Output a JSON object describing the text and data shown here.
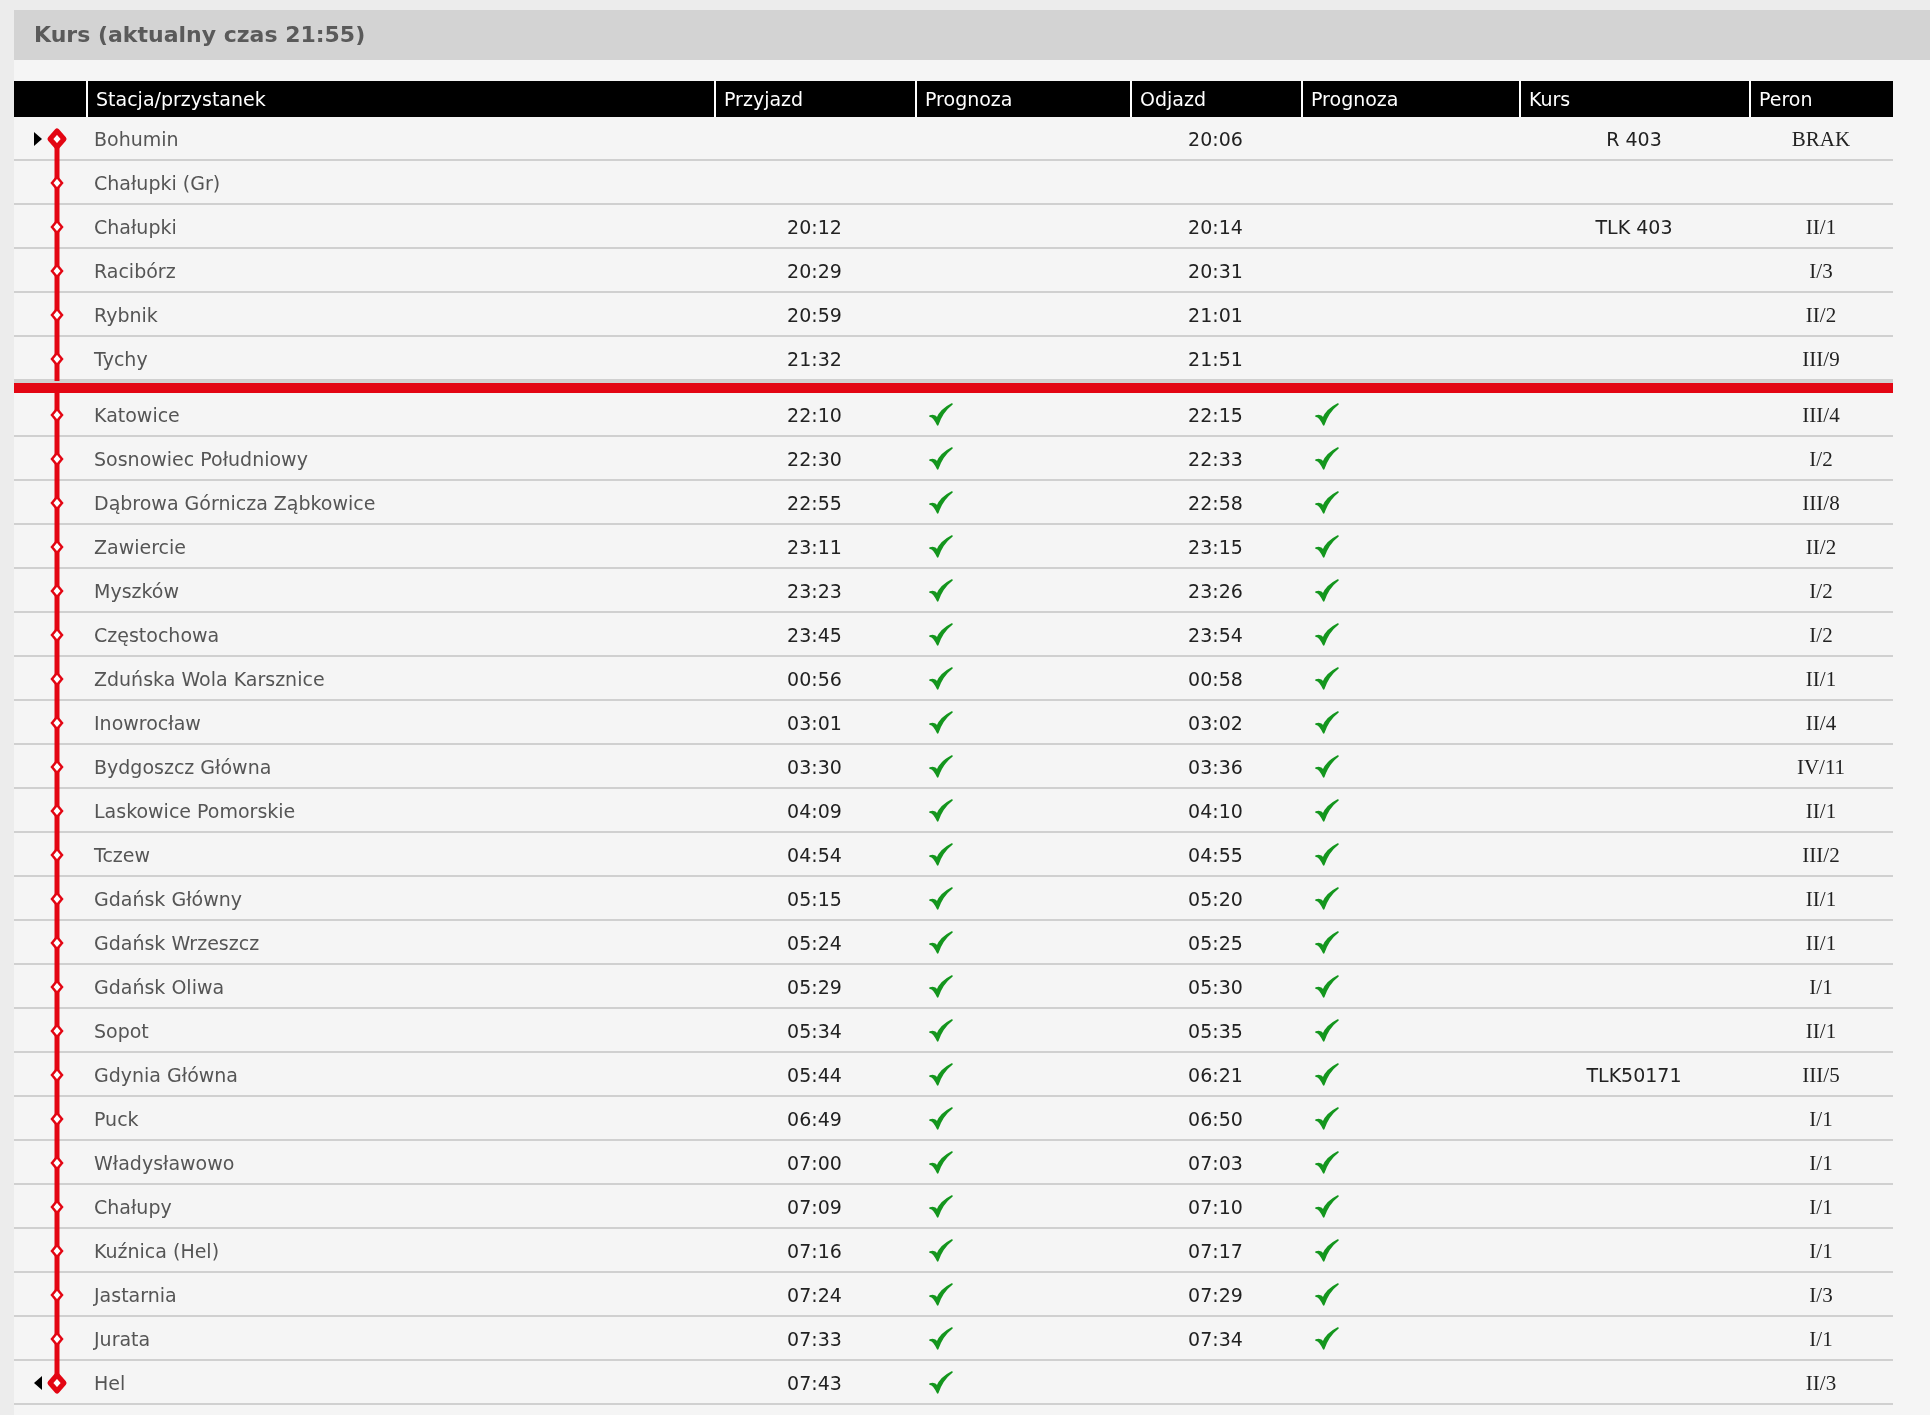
{
  "title": "Kurs (aktualny czas 21:55)",
  "columns": [
    "Stacja/przystanek",
    "Przyjazd",
    "Prognoza",
    "Odjazd",
    "Prognoza",
    "Kurs",
    "Peron"
  ],
  "rows": [
    {
      "kind": "start",
      "station": "Bohumin",
      "departure": "20:06",
      "train": "R 403",
      "platform": "BRAK",
      "arrival_forecast": false,
      "departure_forecast": false
    },
    {
      "kind": "stop",
      "station": "Chałupki (Gr)",
      "arrival_forecast": false,
      "departure_forecast": false
    },
    {
      "kind": "stop",
      "station": "Chałupki",
      "arrival": "20:12",
      "departure": "20:14",
      "train": "TLK 403",
      "platform": "II/1",
      "arrival_forecast": false,
      "departure_forecast": false
    },
    {
      "kind": "stop",
      "station": "Racibórz",
      "arrival": "20:29",
      "departure": "20:31",
      "platform": "I/3",
      "arrival_forecast": false,
      "departure_forecast": false
    },
    {
      "kind": "stop",
      "station": "Rybnik",
      "arrival": "20:59",
      "departure": "21:01",
      "platform": "II/2",
      "arrival_forecast": false,
      "departure_forecast": false
    },
    {
      "kind": "stop",
      "station": "Tychy",
      "arrival": "21:32",
      "departure": "21:51",
      "platform": "III/9",
      "arrival_forecast": false,
      "departure_forecast": false
    },
    {
      "kind": "now"
    },
    {
      "kind": "stop",
      "station": "Katowice",
      "arrival": "22:10",
      "departure": "22:15",
      "platform": "III/4",
      "arrival_forecast": true,
      "departure_forecast": true
    },
    {
      "kind": "stop",
      "station": "Sosnowiec Południowy",
      "arrival": "22:30",
      "departure": "22:33",
      "platform": "I/2",
      "arrival_forecast": true,
      "departure_forecast": true
    },
    {
      "kind": "stop",
      "station": "Dąbrowa Górnicza Ząbkowice",
      "arrival": "22:55",
      "departure": "22:58",
      "platform": "III/8",
      "arrival_forecast": true,
      "departure_forecast": true
    },
    {
      "kind": "stop",
      "station": "Zawiercie",
      "arrival": "23:11",
      "departure": "23:15",
      "platform": "II/2",
      "arrival_forecast": true,
      "departure_forecast": true
    },
    {
      "kind": "stop",
      "station": "Myszków",
      "arrival": "23:23",
      "departure": "23:26",
      "platform": "I/2",
      "arrival_forecast": true,
      "departure_forecast": true
    },
    {
      "kind": "stop",
      "station": "Częstochowa",
      "arrival": "23:45",
      "departure": "23:54",
      "platform": "I/2",
      "arrival_forecast": true,
      "departure_forecast": true
    },
    {
      "kind": "stop",
      "station": "Zduńska Wola Karsznice",
      "arrival": "00:56",
      "departure": "00:58",
      "platform": "II/1",
      "arrival_forecast": true,
      "departure_forecast": true
    },
    {
      "kind": "stop",
      "station": "Inowrocław",
      "arrival": "03:01",
      "departure": "03:02",
      "platform": "II/4",
      "arrival_forecast": true,
      "departure_forecast": true
    },
    {
      "kind": "stop",
      "station": "Bydgoszcz Główna",
      "arrival": "03:30",
      "departure": "03:36",
      "platform": "IV/11",
      "arrival_forecast": true,
      "departure_forecast": true
    },
    {
      "kind": "stop",
      "station": "Laskowice Pomorskie",
      "arrival": "04:09",
      "departure": "04:10",
      "platform": "II/1",
      "arrival_forecast": true,
      "departure_forecast": true
    },
    {
      "kind": "stop",
      "station": "Tczew",
      "arrival": "04:54",
      "departure": "04:55",
      "platform": "III/2",
      "arrival_forecast": true,
      "departure_forecast": true
    },
    {
      "kind": "stop",
      "station": "Gdańsk Główny",
      "arrival": "05:15",
      "departure": "05:20",
      "platform": "II/1",
      "arrival_forecast": true,
      "departure_forecast": true
    },
    {
      "kind": "stop",
      "station": "Gdańsk Wrzeszcz",
      "arrival": "05:24",
      "departure": "05:25",
      "platform": "II/1",
      "arrival_forecast": true,
      "departure_forecast": true
    },
    {
      "kind": "stop",
      "station": "Gdańsk Oliwa",
      "arrival": "05:29",
      "departure": "05:30",
      "platform": "I/1",
      "arrival_forecast": true,
      "departure_forecast": true
    },
    {
      "kind": "stop",
      "station": "Sopot",
      "arrival": "05:34",
      "departure": "05:35",
      "platform": "II/1",
      "arrival_forecast": true,
      "departure_forecast": true
    },
    {
      "kind": "stop",
      "station": "Gdynia Główna",
      "arrival": "05:44",
      "departure": "06:21",
      "train": "TLK50171",
      "platform": "III/5",
      "arrival_forecast": true,
      "departure_forecast": true
    },
    {
      "kind": "stop",
      "station": "Puck",
      "arrival": "06:49",
      "departure": "06:50",
      "platform": "I/1",
      "arrival_forecast": true,
      "departure_forecast": true
    },
    {
      "kind": "stop",
      "station": "Władysławowo",
      "arrival": "07:00",
      "departure": "07:03",
      "platform": "I/1",
      "arrival_forecast": true,
      "departure_forecast": true
    },
    {
      "kind": "stop",
      "station": "Chałupy",
      "arrival": "07:09",
      "departure": "07:10",
      "platform": "I/1",
      "arrival_forecast": true,
      "departure_forecast": true
    },
    {
      "kind": "stop",
      "station": "Kuźnica (Hel)",
      "arrival": "07:16",
      "departure": "07:17",
      "platform": "I/1",
      "arrival_forecast": true,
      "departure_forecast": true
    },
    {
      "kind": "stop",
      "station": "Jastarnia",
      "arrival": "07:24",
      "departure": "07:29",
      "platform": "I/3",
      "arrival_forecast": true,
      "departure_forecast": true
    },
    {
      "kind": "stop",
      "station": "Jurata",
      "arrival": "07:33",
      "departure": "07:34",
      "platform": "I/1",
      "arrival_forecast": true,
      "departure_forecast": true
    },
    {
      "kind": "end",
      "station": "Hel",
      "arrival": "07:43",
      "platform": "II/3",
      "arrival_forecast": true,
      "departure_forecast": false
    }
  ]
}
